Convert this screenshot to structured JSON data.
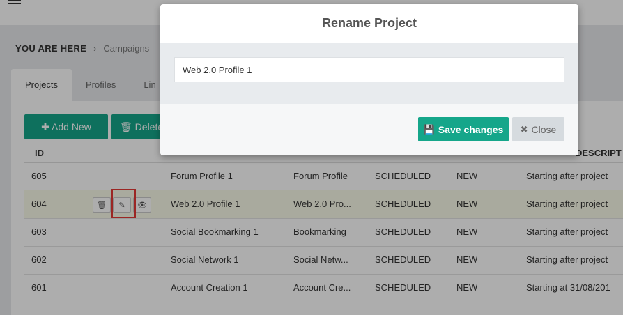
{
  "breadcrumb": {
    "here": "YOU ARE HERE",
    "separator": "›",
    "first": "Campaigns"
  },
  "tabs": [
    {
      "label": "Projects",
      "active": true
    },
    {
      "label": "Profiles",
      "active": false
    },
    {
      "label": "Lin",
      "active": false
    }
  ],
  "toolbar": {
    "add_label": "Add New",
    "delete_label": "Delete"
  },
  "table": {
    "headers": {
      "id": "ID",
      "description": "DESCRIPT"
    },
    "rows": [
      {
        "id": "605",
        "name": "Forum Profile 1",
        "type": "Forum Profile",
        "status": "SCHEDULED",
        "state": "NEW",
        "description": "Starting after project"
      },
      {
        "id": "604",
        "name": "Web 2.0 Profile 1",
        "type": "Web 2.0 Pro...",
        "status": "SCHEDULED",
        "state": "NEW",
        "description": "Starting after project"
      },
      {
        "id": "603",
        "name": "Social Bookmarking 1",
        "type": "Bookmarking",
        "status": "SCHEDULED",
        "state": "NEW",
        "description": "Starting after project"
      },
      {
        "id": "602",
        "name": "Social Network 1",
        "type": "Social Netw...",
        "status": "SCHEDULED",
        "state": "NEW",
        "description": "Starting after project"
      },
      {
        "id": "601",
        "name": "Account Creation 1",
        "type": "Account Cre...",
        "status": "SCHEDULED",
        "state": "NEW",
        "description": "Starting at 31/08/201"
      }
    ]
  },
  "modal": {
    "title": "Rename Project",
    "input_value": "Web 2.0 Profile 1",
    "save_label": "Save changes",
    "close_label": "Close"
  },
  "colors": {
    "accent": "#15a68a",
    "highlight_box": "#e53935"
  }
}
